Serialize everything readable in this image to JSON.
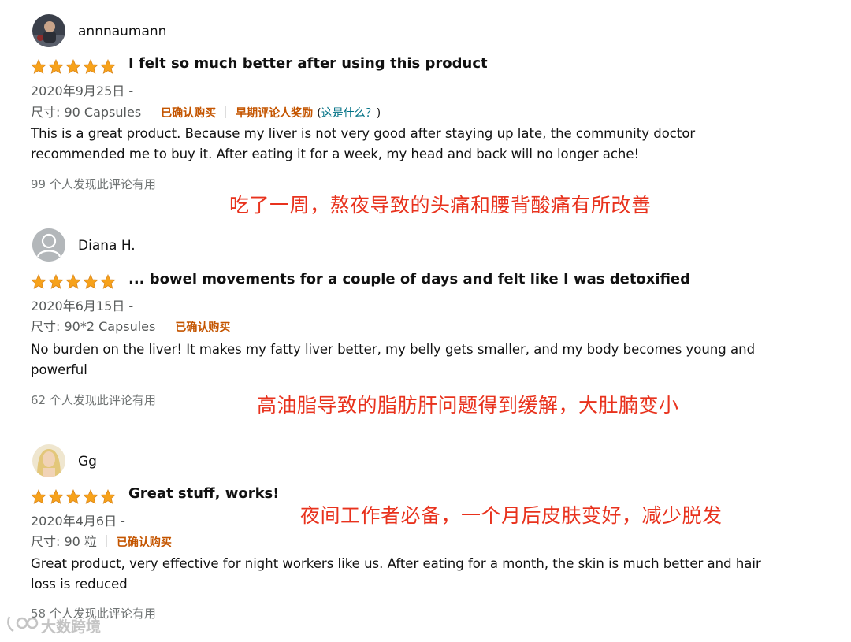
{
  "reviews": [
    {
      "username": "annnaumann",
      "avatar_icon": "user-photo-icon",
      "rating": 5,
      "title": "I felt so much better after using this product",
      "date": "2020年9月25日 -",
      "size": "尺寸: 90 Capsules",
      "verified": "已确认购买",
      "vine": "早期评论人奖励",
      "vine_help_open": "(",
      "vine_help": "这是什么？",
      "vine_help_close": ")",
      "text": "This is a great product. Because my liver is not very good after staying up late, the community doctor recommended me to buy it. After eating it for a week, my head and back will no longer ache!",
      "helpful": "99 个人发现此评论有用",
      "annotation": "吃了一周，熬夜导致的头痛和腰背酸痛有所改善"
    },
    {
      "username": "Diana H.",
      "avatar_icon": "default-user-icon",
      "rating": 5,
      "title": "... bowel movements for a couple of days and felt like I was detoxified",
      "date": "2020年6月15日 -",
      "size": "尺寸: 90*2 Capsules",
      "verified": "已确认购买",
      "text": "No burden on the liver! It makes my fatty liver better, my belly gets smaller, and my body becomes young and powerful",
      "helpful": "62 个人发现此评论有用",
      "annotation": "高油脂导致的脂肪肝问题得到缓解，大肚腩变小"
    },
    {
      "username": "Gg",
      "avatar_icon": "user-photo-icon",
      "rating": 5,
      "title": "Great stuff, works!",
      "date": "2020年4月6日 -",
      "size": "尺寸: 90 粒",
      "verified": "已确认购买",
      "text": "Great product, very effective for night workers like us. After eating for a month, the skin is much better and hair loss is reduced",
      "helpful": "58 个人发现此评论有用",
      "annotation": "夜间工作者必备，一个月后皮肤变好，减少脱发"
    }
  ],
  "watermark": {
    "text": "大数跨境",
    "icon": "brand-logo-icon"
  },
  "colors": {
    "star": "#f7a21b",
    "verified": "#c45500",
    "link": "#007185",
    "annotation": "#e8321d"
  }
}
